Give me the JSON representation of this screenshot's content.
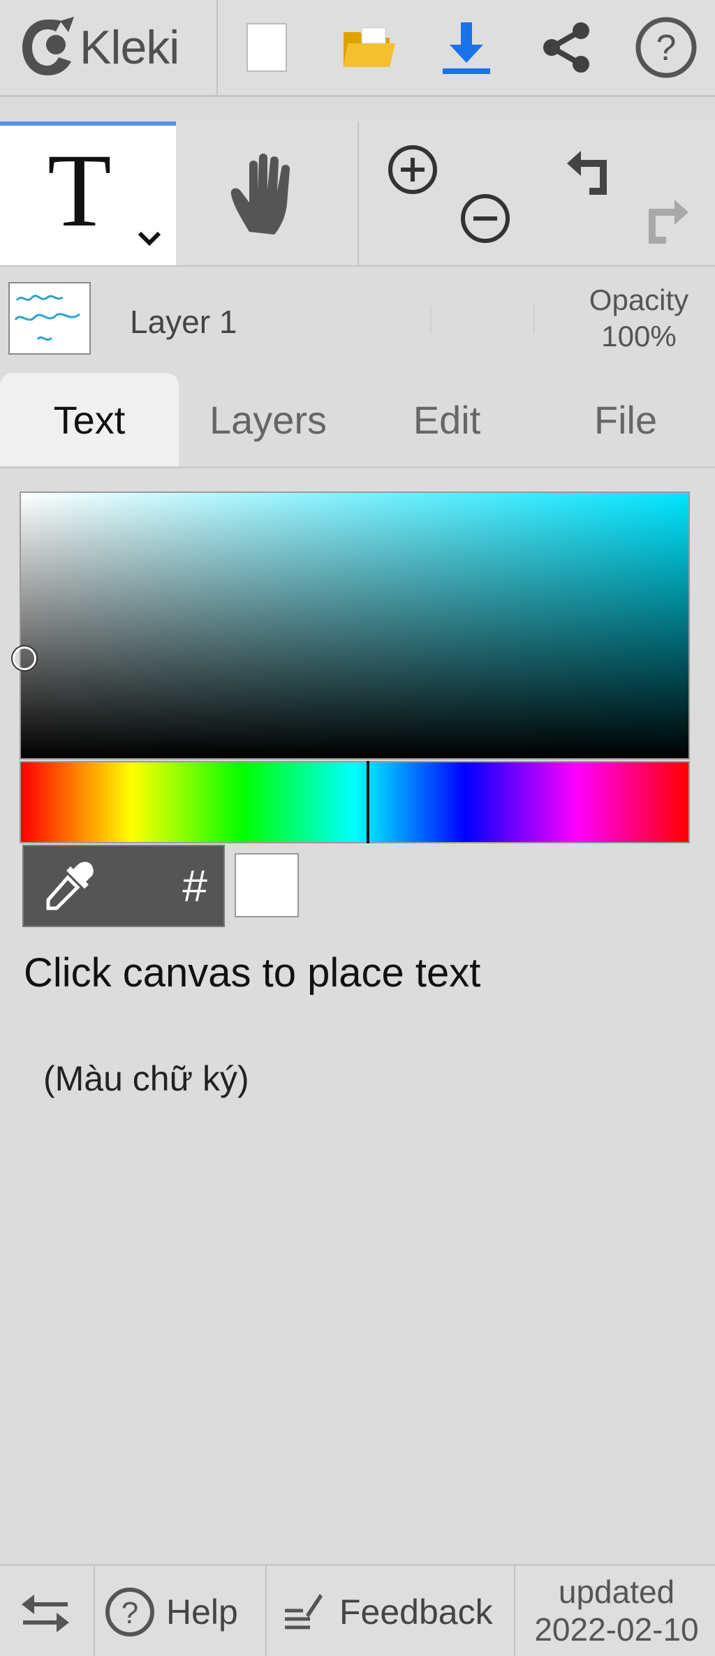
{
  "topbar": {
    "logo_text": "Kleki",
    "icons": [
      "kleki-logo-icon",
      "new-file-icon",
      "open-folder-icon",
      "download-icon",
      "share-icon",
      "help-circle-icon"
    ]
  },
  "tools": {
    "text_tool_glyph": "T",
    "icons": [
      "text-tool-icon",
      "hand-tool-icon",
      "zoom-in-icon",
      "zoom-out-icon",
      "undo-icon",
      "redo-icon"
    ]
  },
  "layer": {
    "name": "Layer 1",
    "opacity_label": "Opacity",
    "opacity_value": "100%"
  },
  "tabs": [
    {
      "label": "Text",
      "active": true
    },
    {
      "label": "Layers",
      "active": false
    },
    {
      "label": "Edit",
      "active": false
    },
    {
      "label": "File",
      "active": false
    }
  ],
  "color_picker": {
    "hue_color": "#00e5ff",
    "current_color": "#ffffff",
    "hex_button_label": "#"
  },
  "panel": {
    "hint": "Click canvas to place text",
    "extra_label": "(Màu chữ ký)"
  },
  "bottombar": {
    "help_label": "Help",
    "feedback_label": "Feedback",
    "updated_label": "updated",
    "updated_date": "2022-02-10"
  },
  "colors": {
    "accent": "#5b8eef",
    "download_blue": "#1a73e8",
    "folder_yellow": "#f5b400"
  }
}
